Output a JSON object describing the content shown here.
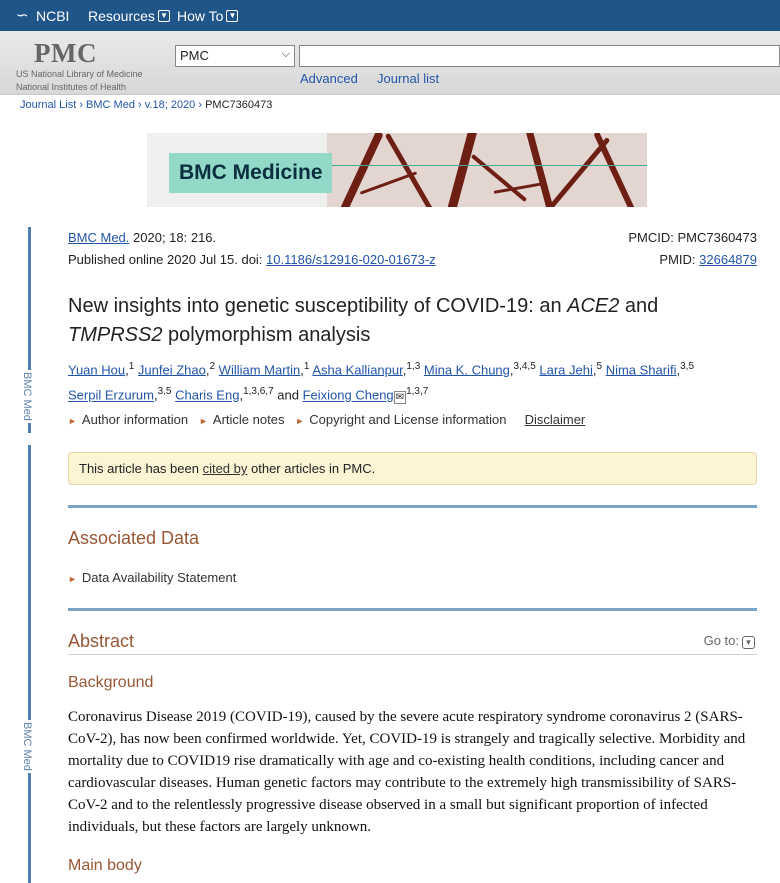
{
  "topbar": {
    "brand": "NCBI",
    "brand_icon": "ncbi-helix-icon",
    "resources": "Resources",
    "howto": "How To"
  },
  "search": {
    "logo": "PMC",
    "org_line1": "US National Library of Medicine",
    "org_line2": "National Institutes of Health",
    "db_value": "PMC",
    "query": "",
    "advanced": "Advanced",
    "journal_list": "Journal list"
  },
  "breadcrumb": {
    "journal_list": "Journal List",
    "journal": "BMC Med",
    "volume": "v.18; 2020",
    "current": "PMC7360473"
  },
  "banner": {
    "text": "BMC Medicine"
  },
  "article": {
    "journal_link": "BMC Med.",
    "citation": " 2020; 18: 216.",
    "published": "Published online 2020 Jul 15. doi: ",
    "doi": "10.1186/s12916-020-01673-z",
    "pmcid": "PMCID: PMC7360473",
    "pmid_label": "PMID: ",
    "pmid": "32664879",
    "title_a": "New insights into genetic susceptibility of COVID-19: an ",
    "title_gene1": "ACE2",
    "title_b": " and ",
    "title_gene2": "TMPRSS2",
    "title_c": " polymorphism analysis",
    "authors": [
      {
        "name": "Yuan Hou",
        "sup": "1"
      },
      {
        "name": "Junfei Zhao",
        "sup": "2"
      },
      {
        "name": "William Martin",
        "sup": "1"
      },
      {
        "name": "Asha Kallianpur",
        "sup": "1,3"
      },
      {
        "name": "Mina K. Chung",
        "sup": "3,4,5"
      },
      {
        "name": "Lara Jehi",
        "sup": "5"
      },
      {
        "name": "Nima Sharifi",
        "sup": "3,5"
      },
      {
        "name": "Serpil Erzurum",
        "sup": "3,5"
      },
      {
        "name": "Charis Eng",
        "sup": "1,3,6,7"
      },
      {
        "name": "Feixiong Cheng",
        "sup": "1,3,7"
      }
    ],
    "and": "and",
    "tabs": {
      "author_info": "Author information",
      "article_notes": "Article notes",
      "copyright": "Copyright and License information",
      "disclaimer": "Disclaimer"
    },
    "notice_a": "This article has been ",
    "notice_link": "cited by",
    "notice_b": " other articles in PMC."
  },
  "rail_label": "BMC Med",
  "sections": {
    "associated": "Associated Data",
    "data_availability": "Data Availability Statement",
    "abstract": "Abstract",
    "goto": "Go to:",
    "background": "Background",
    "background_text": "Coronavirus Disease 2019 (COVID-19), caused by the severe acute respiratory syndrome coronavirus 2 (SARS-CoV-2), has now been confirmed worldwide. Yet, COVID-19 is strangely and tragically selective. Morbidity and mortality due to COVID19 rise dramatically with age and co-existing health conditions, including cancer and cardiovascular diseases. Human genetic factors may contribute to the extremely high transmissibility of SARS-CoV-2 and to the relentlessly progressive disease observed in a small but significant proportion of infected individuals, but these factors are largely unknown.",
    "main_body": "Main body"
  },
  "colors": {
    "ncbi_blue": "#20558a",
    "link": "#2255aa",
    "section_brown": "#985735",
    "rail_blue": "#4f7fae"
  }
}
